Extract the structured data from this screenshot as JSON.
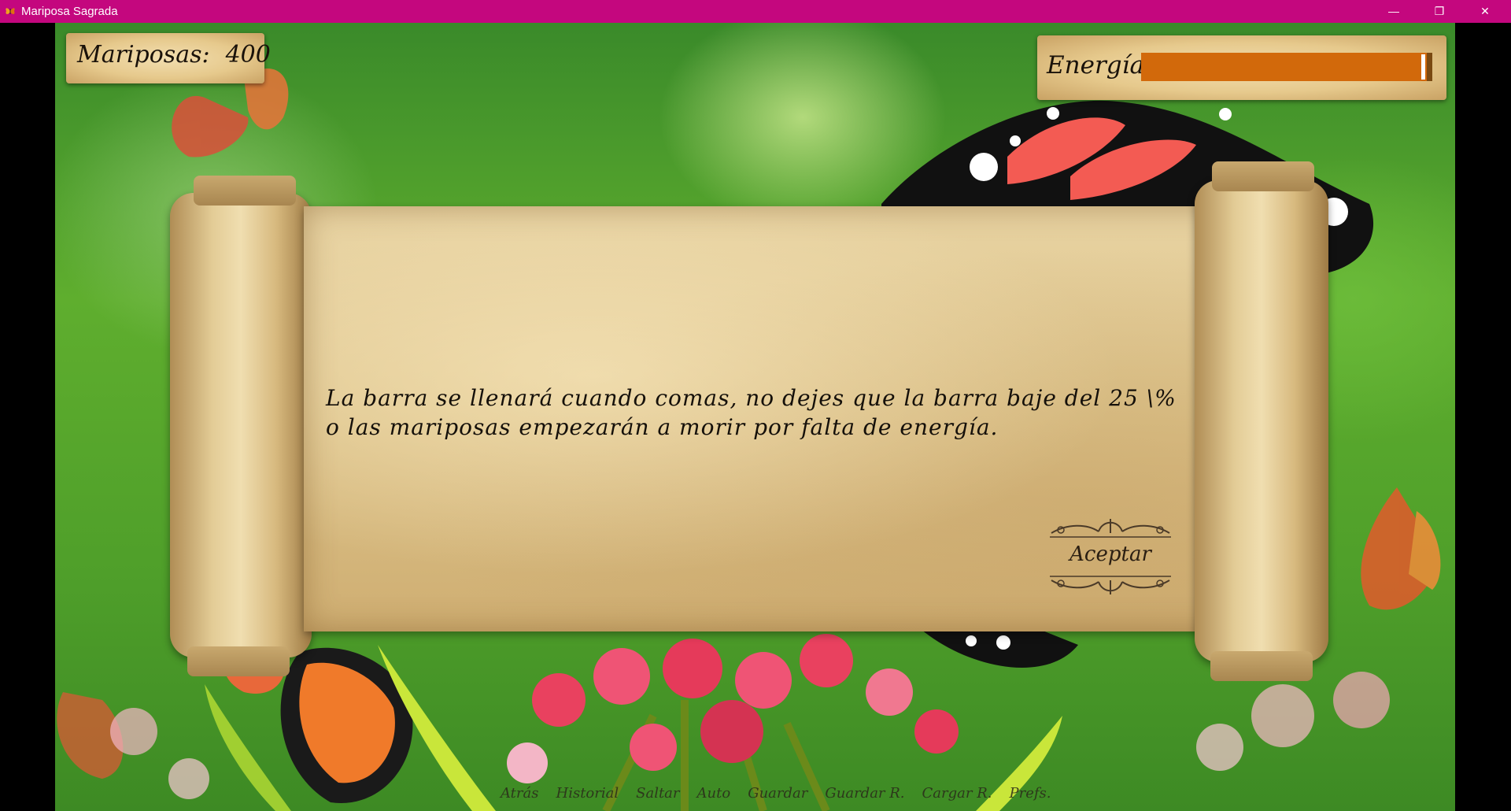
{
  "window": {
    "title": "Mariposa Sagrada",
    "controls": {
      "minimize": "—",
      "maximize": "❐",
      "close": "✕"
    },
    "titlebar_color": "#c4077e"
  },
  "hud": {
    "butterflies_label": "Mariposas:",
    "butterflies_value": "400",
    "energy_label": "Energía",
    "energy_level_fraction": 0.98,
    "energy_color": "#d2690b"
  },
  "dialog": {
    "text": "La barra se llenará cuando comas, no dejes que la barra baje del 25 \\% o las mariposas empezarán a morir por falta de energía.",
    "accept_label": "Aceptar"
  },
  "quick_menu": {
    "items": [
      "Atrás",
      "Historial",
      "Saltar",
      "Auto",
      "Guardar",
      "Guardar R.",
      "Cargar R.",
      "Prefs."
    ]
  },
  "icons": [
    "butterfly-app-icon",
    "minimize-icon",
    "maximize-icon",
    "close-icon"
  ]
}
